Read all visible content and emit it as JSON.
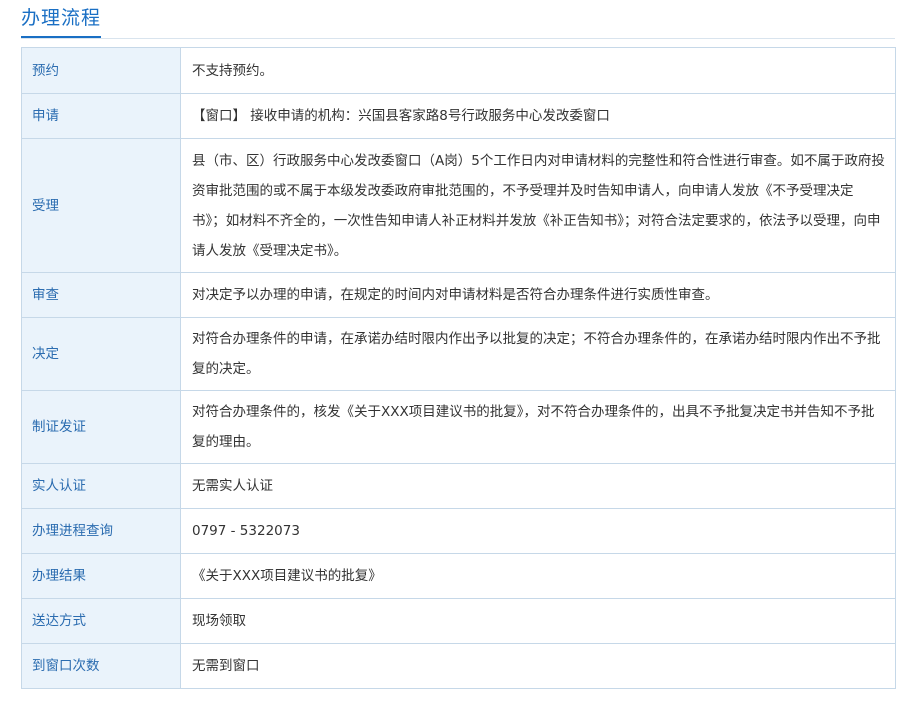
{
  "section": {
    "title": "办理流程"
  },
  "rows": [
    {
      "label": "预约",
      "value": "不支持预约。"
    },
    {
      "label": "申请",
      "value": "【窗口】 接收申请的机构：兴国县客家路8号行政服务中心发改委窗口"
    },
    {
      "label": "受理",
      "value": "县（市、区）行政服务中心发改委窗口（A岗）5个工作日内对申请材料的完整性和符合性进行审查。如不属于政府投资审批范围的或不属于本级发改委政府审批范围的，不予受理并及时告知申请人，向申请人发放《不予受理决定书》；如材料不齐全的，一次性告知申请人补正材料并发放《补正告知书》；对符合法定要求的，依法予以受理，向申请人发放《受理决定书》。"
    },
    {
      "label": "审查",
      "value": "对决定予以办理的申请，在规定的时间内对申请材料是否符合办理条件进行实质性审查。"
    },
    {
      "label": "决定",
      "value": "对符合办理条件的申请，在承诺办结时限内作出予以批复的决定；不符合办理条件的，在承诺办结时限内作出不予批复的决定。"
    },
    {
      "label": "制证发证",
      "value": "对符合办理条件的，核发《关于XXX项目建议书的批复》，对不符合办理条件的，出具不予批复决定书并告知不予批复的理由。"
    },
    {
      "label": "实人认证",
      "value": "无需实人认证"
    },
    {
      "label": "办理进程查询",
      "value": "0797 - 5322073"
    },
    {
      "label": "办理结果",
      "value": "《关于XXX项目建议书的批复》"
    },
    {
      "label": "送达方式",
      "value": "现场领取"
    },
    {
      "label": "到窗口次数",
      "value": "无需到窗口"
    }
  ]
}
